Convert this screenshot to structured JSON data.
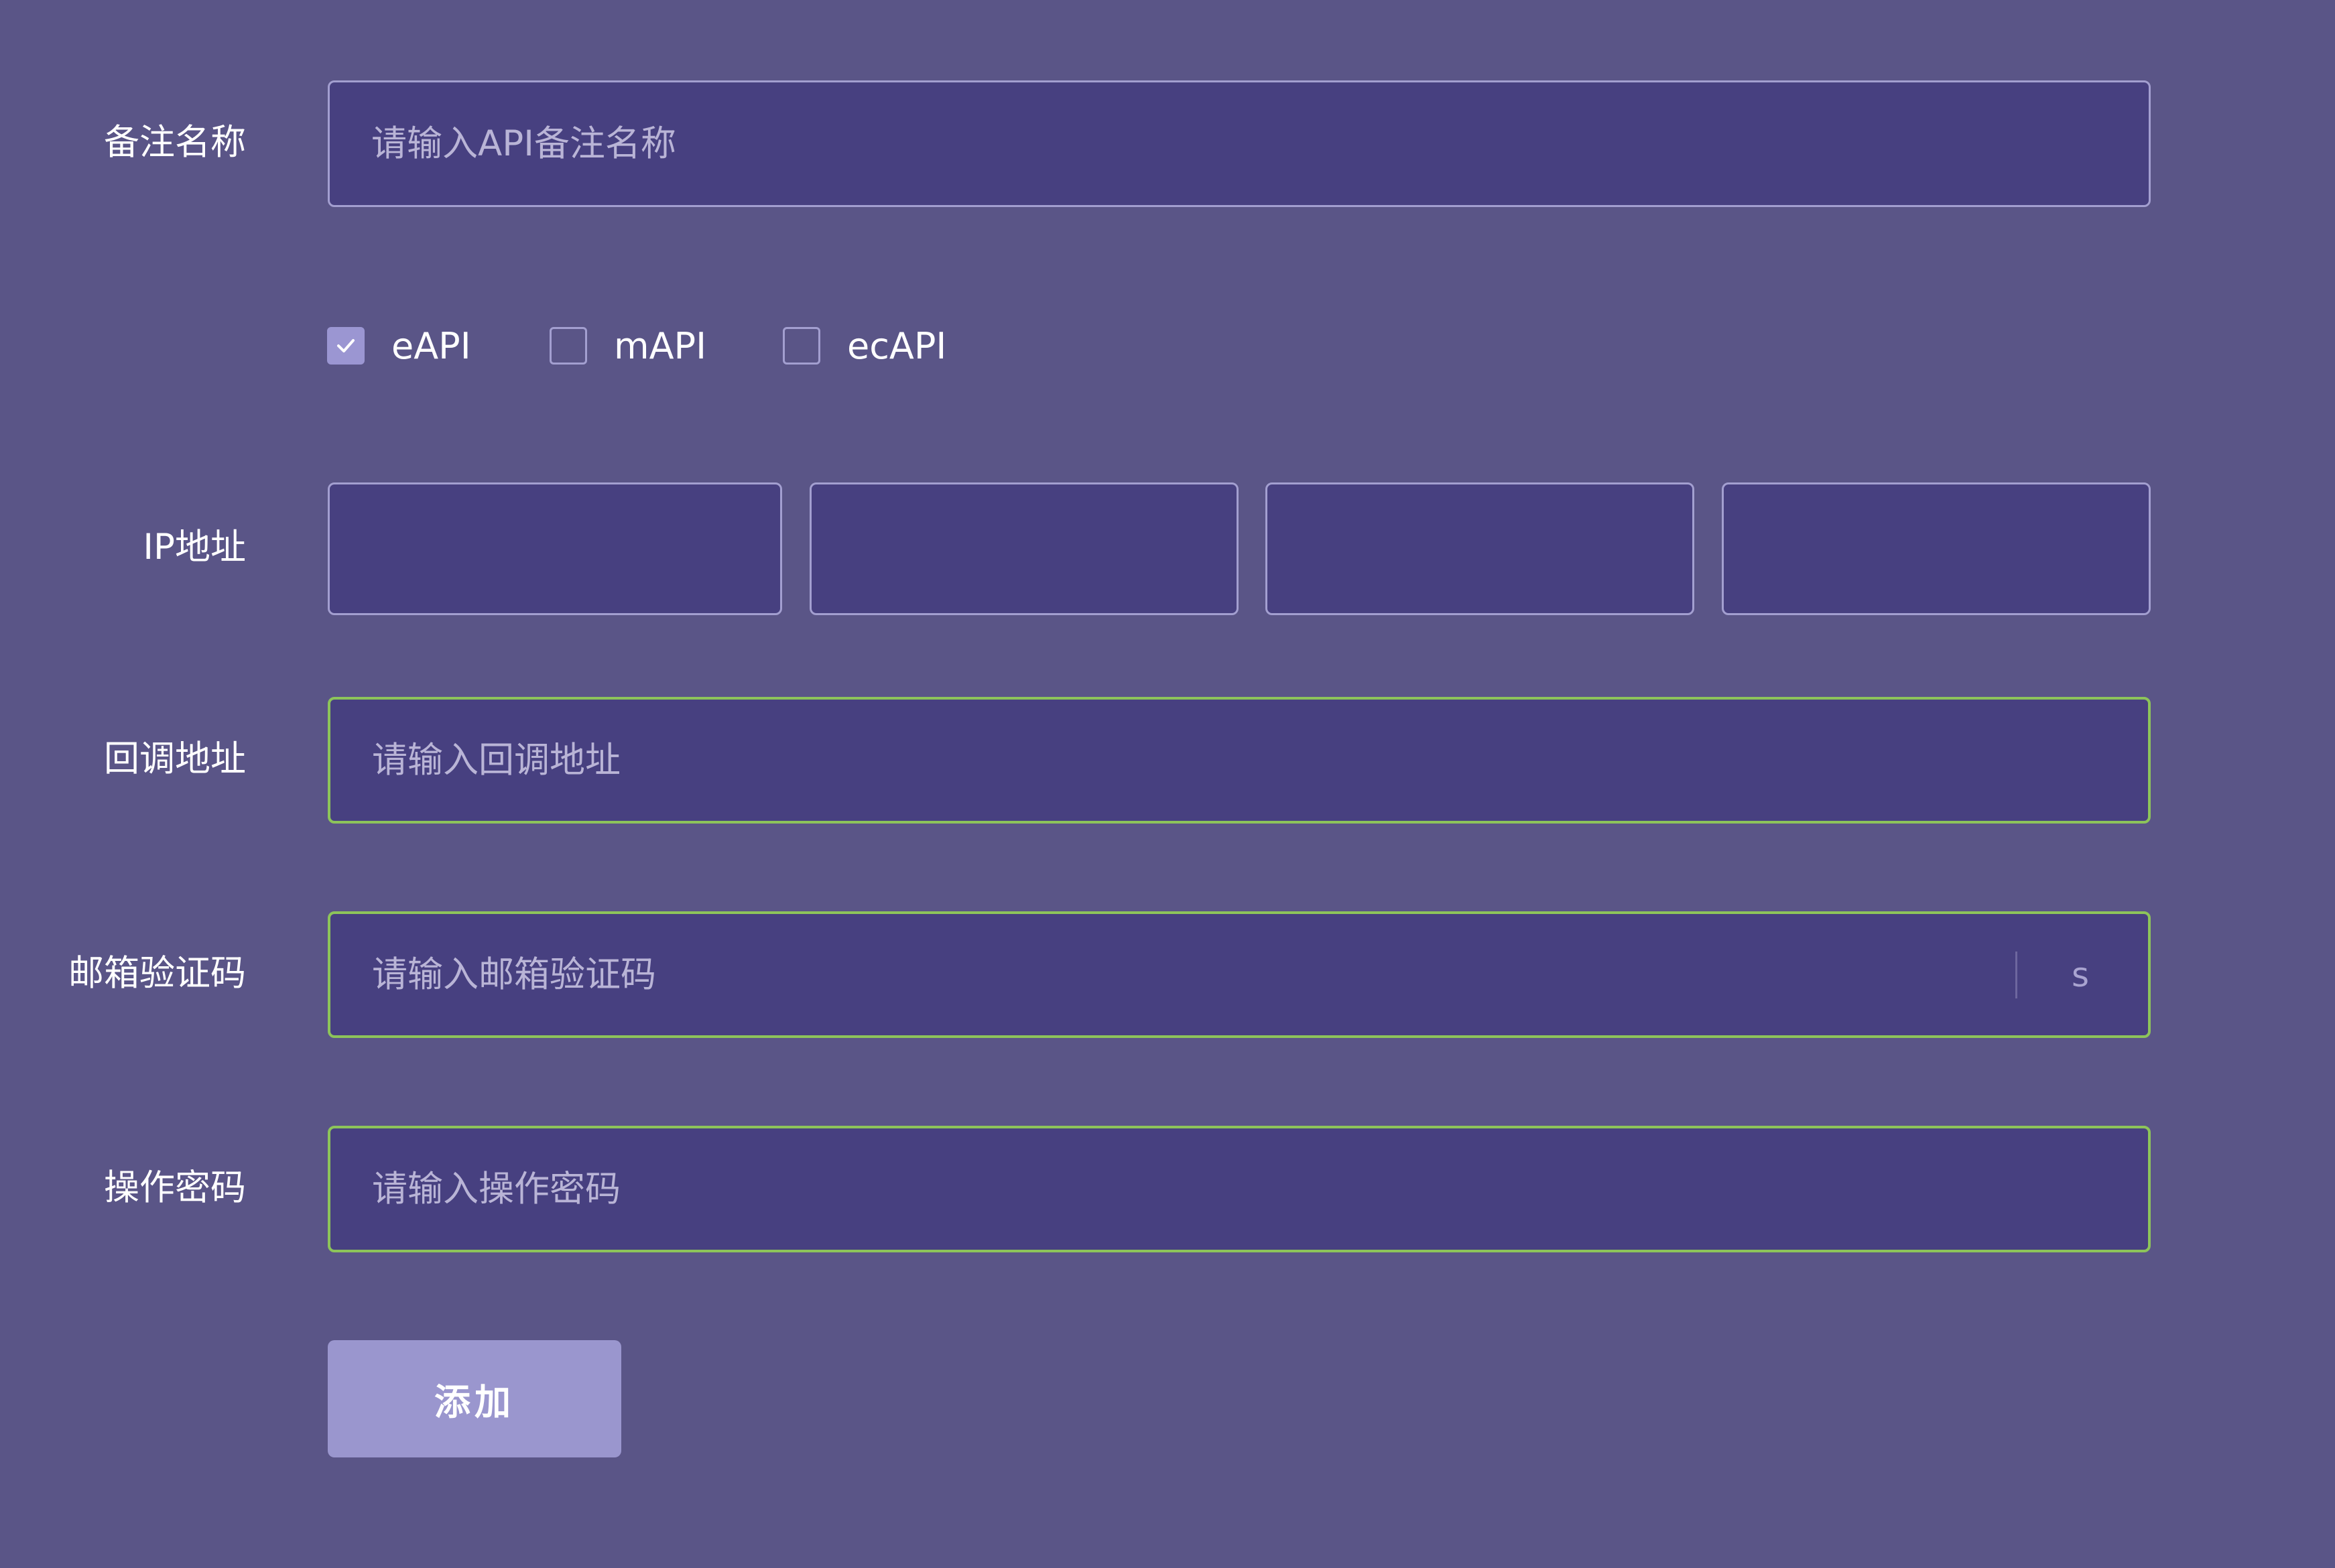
{
  "form": {
    "remark": {
      "label": "备注名称",
      "placeholder": "请输入API备注名称",
      "value": ""
    },
    "api_types": [
      {
        "label": "eAPI",
        "checked": true
      },
      {
        "label": "mAPI",
        "checked": false
      },
      {
        "label": "ecAPI",
        "checked": false
      }
    ],
    "ip": {
      "label": "IP地址",
      "segments": [
        "",
        "",
        "",
        ""
      ]
    },
    "callback": {
      "label": "回调地址",
      "placeholder": "请输入回调地址",
      "value": ""
    },
    "email_code": {
      "label": "邮箱验证码",
      "placeholder": "请输入邮箱验证码",
      "value": "",
      "suffix": "s"
    },
    "op_password": {
      "label": "操作密码",
      "placeholder": "请输入操作密码",
      "value": ""
    },
    "submit_label": "添加"
  },
  "colors": {
    "background": "#5a5587",
    "field_bg": "#474080",
    "field_border": "#a39fd0",
    "valid_border": "#8dc45a",
    "button_bg": "#9a96ce"
  }
}
